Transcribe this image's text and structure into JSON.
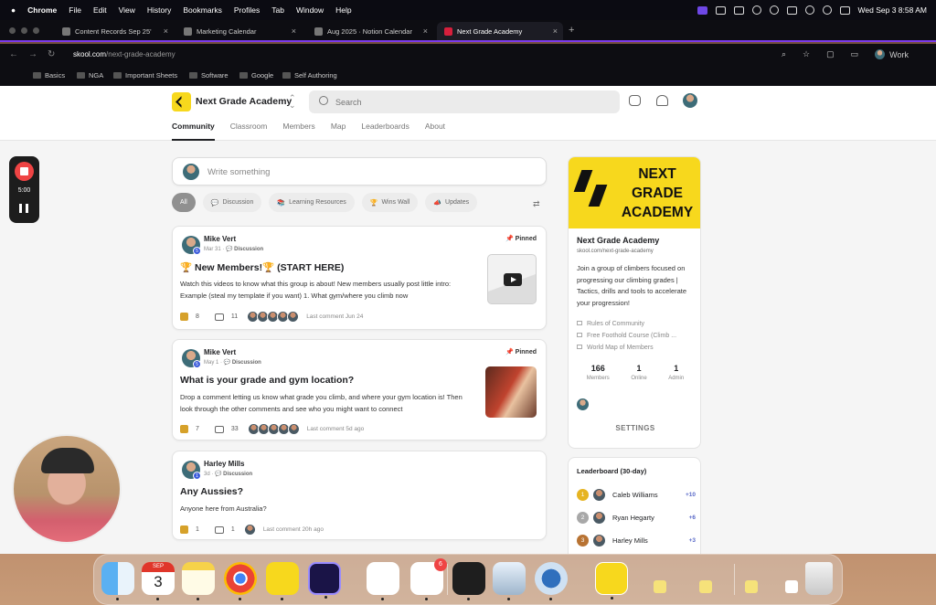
{
  "menubar": {
    "app": "Chrome",
    "menus": [
      "File",
      "Edit",
      "View",
      "History",
      "Bookmarks",
      "Profiles",
      "Tab",
      "Window",
      "Help"
    ],
    "datetime": "Wed Sep 3  8:58 AM"
  },
  "tabs": [
    {
      "title": "Content Records Sep 25'"
    },
    {
      "title": "Marketing Calendar"
    },
    {
      "title": "Aug 2025 · Notion Calendar"
    },
    {
      "title": "Next Grade Academy"
    }
  ],
  "address": {
    "host": "skool.com",
    "path": "/next-grade-academy",
    "profile": "Work"
  },
  "bookmarks": [
    "Basics",
    "NGA",
    "Important Sheets",
    "Software",
    "Google",
    "Self Authoring"
  ],
  "header": {
    "group_name": "Next Grade Academy",
    "search_placeholder": "Search"
  },
  "subnav": [
    "Community",
    "Classroom",
    "Members",
    "Map",
    "Leaderboards",
    "About"
  ],
  "composer": {
    "placeholder": "Write something"
  },
  "filters": [
    {
      "label": "All",
      "emoji": ""
    },
    {
      "label": "Discussion",
      "emoji": "💬"
    },
    {
      "label": "Learning Resources",
      "emoji": "📚"
    },
    {
      "label": "Wins Wall",
      "emoji": "🏆"
    },
    {
      "label": "Updates",
      "emoji": "📣"
    }
  ],
  "posts": [
    {
      "author": "Mike Vert",
      "level": "5",
      "date": "Mar 31",
      "category": "Discussion",
      "pinned": "Pinned",
      "title": "🏆 New Members!🏆 (START HERE)",
      "body": "Watch this videos to know what this group is about! New members usually post little intro: Example (steal my template if you want) 1. What gym/where you climb now",
      "likes": "8",
      "comments": "11",
      "last_comment": "Last comment Jun 24"
    },
    {
      "author": "Mike Vert",
      "level": "5",
      "date": "May 1",
      "category": "Discussion",
      "pinned": "Pinned",
      "title": "What is your grade and gym location?",
      "body": "Drop a comment letting us know what grade you climb, and where your gym location is! Then look through the other comments and see who you might want to connect",
      "likes": "7",
      "comments": "33",
      "last_comment": "Last comment 5d ago"
    },
    {
      "author": "Harley Mills",
      "level": "1",
      "date": "3d",
      "category": "Discussion",
      "pinned": "",
      "title": "Any Aussies?",
      "body": "Anyone here from Australia?",
      "likes": "1",
      "comments": "1",
      "last_comment": "Last comment 20h ago"
    }
  ],
  "about_card": {
    "banner_text": "NEXT GRADE ACADEMY",
    "name": "Next Grade Academy",
    "url": "skool.com/next-grade-academy",
    "description": "Join a group of climbers focused on progressing our climbing grades | Tactics, drills and tools to accelerate your progression!",
    "links": [
      "Rules of Community",
      "Free Foothold Course (Climb ...",
      "World Map of Members"
    ],
    "stats": [
      {
        "value": "166",
        "label": "Members"
      },
      {
        "value": "1",
        "label": "Online"
      },
      {
        "value": "1",
        "label": "Admin"
      }
    ],
    "settings": "SETTINGS"
  },
  "leaderboard": {
    "title": "Leaderboard (30-day)",
    "rows": [
      {
        "rank": "1",
        "name": "Caleb Williams",
        "points": "+10"
      },
      {
        "rank": "2",
        "name": "Ryan Hegarty",
        "points": "+6"
      },
      {
        "rank": "3",
        "name": "Harley Mills",
        "points": "+3"
      }
    ]
  },
  "recorder": {
    "time": "5:00"
  },
  "dock": {
    "calendar_month": "SEP",
    "calendar_day": "3",
    "task_badge": "6"
  },
  "colors": {
    "accent_yellow": "#f7d81d",
    "tab_underline": "#7c3aed",
    "record_red": "#ef4444"
  }
}
